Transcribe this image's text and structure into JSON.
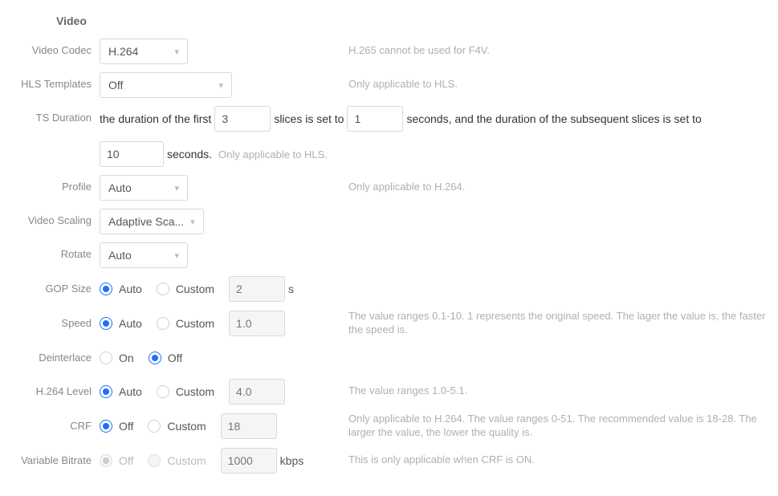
{
  "section": {
    "title": "Video"
  },
  "labels": {
    "video_codec": "Video Codec",
    "hls_templates": "HLS Templates",
    "ts_duration": "TS Duration",
    "profile": "Profile",
    "video_scaling": "Video Scaling",
    "rotate": "Rotate",
    "gop_size": "GOP Size",
    "speed": "Speed",
    "deinterlace": "Deinterlace",
    "h264_level": "H.264 Level",
    "crf": "CRF",
    "variable_bitrate": "Variable Bitrate"
  },
  "common": {
    "auto": "Auto",
    "custom": "Custom",
    "on": "On",
    "off": "Off"
  },
  "video_codec": {
    "value": "H.264",
    "hint": "H.265 cannot be used for F4V."
  },
  "hls_templates": {
    "value": "Off",
    "hint": "Only applicable to HLS."
  },
  "ts_duration": {
    "t1": "the duration of the first",
    "first": "3",
    "t2": "slices is set to",
    "seconds": "1",
    "t3": "seconds, and the duration of the subsequent slices is set to",
    "subsequent": "10",
    "t4": "seconds.",
    "hint": "Only applicable to HLS."
  },
  "profile": {
    "value": "Auto",
    "hint": "Only applicable to H.264."
  },
  "video_scaling": {
    "value": "Adaptive Sca..."
  },
  "rotate": {
    "value": "Auto"
  },
  "gop_size": {
    "mode": "Auto",
    "custom": "2",
    "unit": "s"
  },
  "speed": {
    "mode": "Auto",
    "custom": "1.0",
    "hint": "The value ranges 0.1-10. 1 represents the original speed. The lager the value is, the faster the speed is."
  },
  "deinterlace": {
    "mode": "Off"
  },
  "h264_level": {
    "mode": "Auto",
    "custom": "4.0",
    "hint": "The value ranges 1.0-5.1."
  },
  "crf": {
    "mode": "Off",
    "custom": "18",
    "hint": "Only applicable to H.264. The value ranges 0-51. The recommended value is 18-28. The larger the value, the lower the quality is."
  },
  "variable_bitrate": {
    "mode": "Off",
    "custom": "1000",
    "unit": "kbps",
    "hint": "This is only applicable when CRF is ON."
  }
}
